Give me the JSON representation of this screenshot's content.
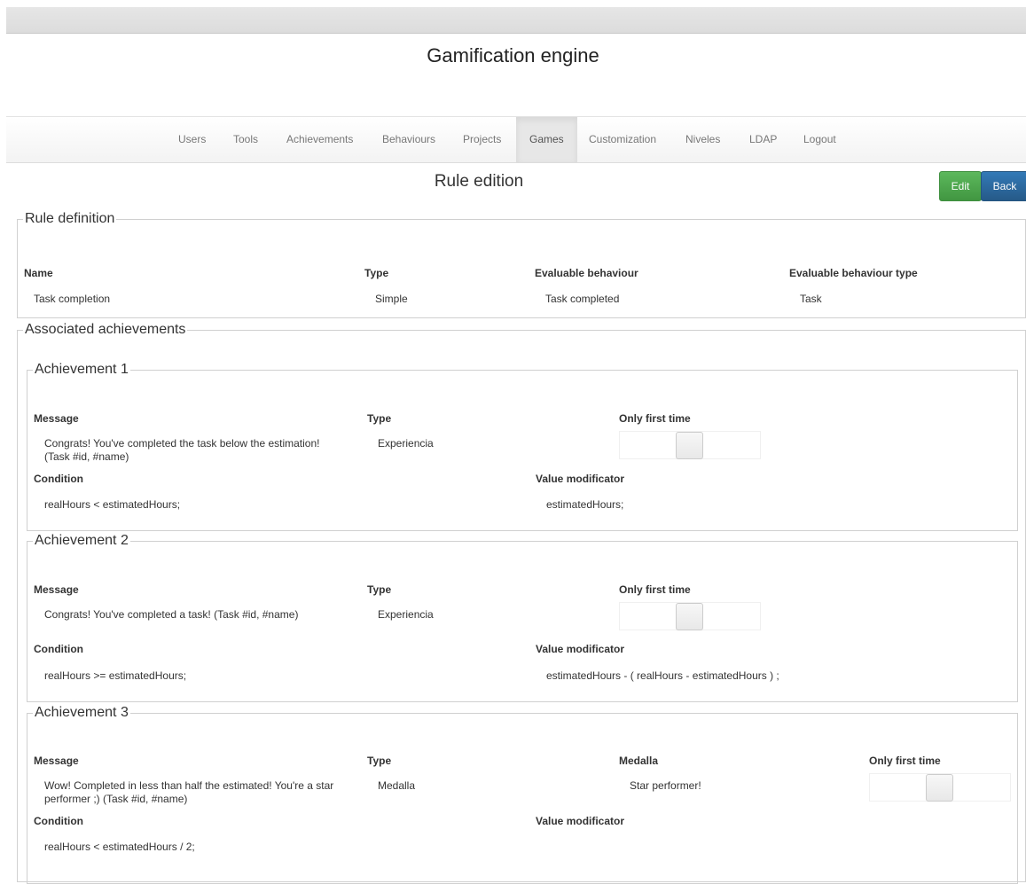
{
  "app": {
    "title": "Gamification engine"
  },
  "nav": {
    "items": [
      "Users",
      "Tools",
      "Achievements",
      "Behaviours",
      "Projects",
      "Games",
      "Customization",
      "Niveles",
      "LDAP",
      "Logout"
    ],
    "active": "Games"
  },
  "page": {
    "title": "Rule edition",
    "edit_label": "Edit",
    "back_label": "Back"
  },
  "rule": {
    "legend": "Rule definition",
    "headers": {
      "name": "Name",
      "type": "Type",
      "behaviour": "Evaluable behaviour",
      "behaviour_type": "Evaluable behaviour type"
    },
    "values": {
      "name": "Task completion",
      "type": "Simple",
      "behaviour": "Task completed",
      "behaviour_type": "Task"
    }
  },
  "associated": {
    "legend": "Associated achievements",
    "labels": {
      "message": "Message",
      "type": "Type",
      "only_first": "Only first time",
      "condition": "Condition",
      "value_modificator": "Value modificator",
      "medalla": "Medalla"
    },
    "achievements": [
      {
        "legend": "Achievement 1",
        "message": "Congrats! You've completed the task below the estimation! (Task #id, #name)",
        "type": "Experiencia",
        "condition": "realHours < estimatedHours;",
        "value_modificator": "estimatedHours;",
        "only_first_time": false
      },
      {
        "legend": "Achievement 2",
        "message": "Congrats! You've completed a task! (Task #id, #name)",
        "type": "Experiencia",
        "condition": "realHours >= estimatedHours;",
        "value_modificator": "estimatedHours - ( realHours - estimatedHours ) ;",
        "only_first_time": false
      },
      {
        "legend": "Achievement 3",
        "message": "Wow! Completed in less than half the estimated! You're a star performer ;) (Task #id, #name)",
        "type": "Medalla",
        "medalla": "Star performer!",
        "condition": "realHours < estimatedHours / 2;",
        "value_modificator": "",
        "only_first_time": false
      }
    ]
  },
  "colors": {
    "edit_button": "#4cae4c",
    "back_button": "#2e6da4"
  }
}
